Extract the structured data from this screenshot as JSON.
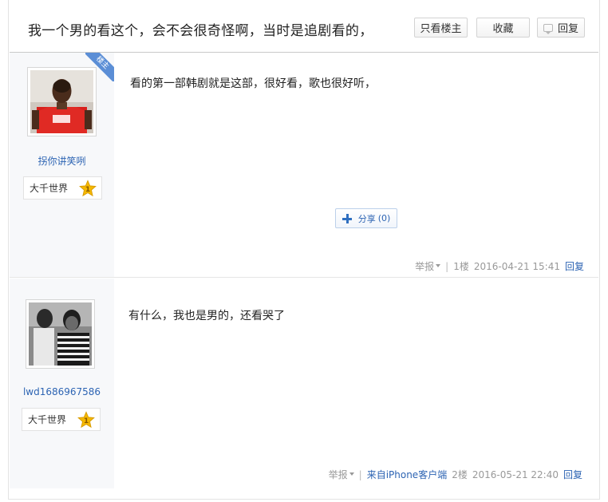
{
  "thread": {
    "title": "我一个男的看这个，会不会很奇怪啊，当时是追剧看的，",
    "only_op_label": "只看楼主",
    "favorite_label": "收藏",
    "reply_label": "回复"
  },
  "posts": [
    {
      "username": "拐你讲笑咧",
      "badge_label": "大千世界",
      "badge_level": "1",
      "op_ribbon": "楼主",
      "content": "看的第一部韩剧就是这部，很好看，歌也很好听，",
      "share_label": "分享",
      "share_count": "(0)",
      "report_label": "举报",
      "floor": "1楼",
      "datetime": "2016-04-21 15:41",
      "reply_label": "回复"
    },
    {
      "username": "lwd1686967586",
      "badge_label": "大千世界",
      "badge_level": "1",
      "content": "有什么，我也是男的，还看哭了",
      "report_label": "举报",
      "source": "来自iPhone客户端",
      "floor": "2楼",
      "datetime": "2016-05-21 22:40",
      "reply_label": "回复"
    }
  ],
  "colors": {
    "link": "#2d64b3",
    "ribbon": "#5b8ed6",
    "meta_text": "#999999",
    "star": "#f5b800"
  }
}
